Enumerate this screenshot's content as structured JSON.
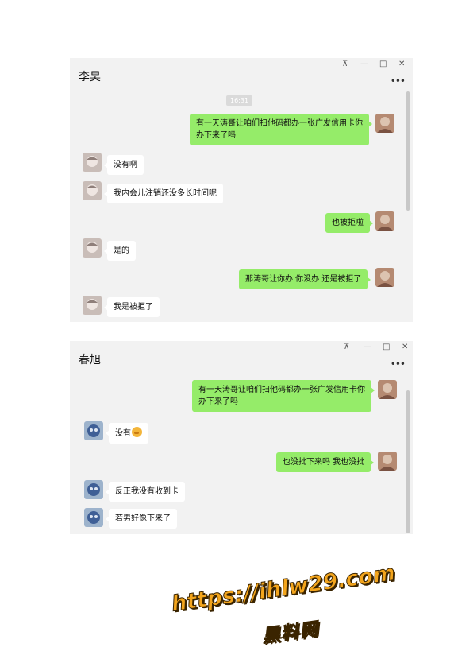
{
  "windows": [
    {
      "title": "李昊",
      "controls": {
        "pin": "⊼",
        "minimize": "—",
        "maximize": "□",
        "close": "✕"
      },
      "more": "•••",
      "timestamp": "16:31",
      "messages": [
        {
          "side": "me",
          "text": "有一天涛哥让咱们扫他码都办一张广发信用卡你办下来了吗"
        },
        {
          "side": "other",
          "text": "没有啊"
        },
        {
          "side": "other",
          "text": "我内会儿注销还没多长时间呢"
        },
        {
          "side": "me",
          "text": "也被拒啦"
        },
        {
          "side": "other",
          "text": "是的"
        },
        {
          "side": "me",
          "text": "那涛哥让你办 你没办 还是被拒了"
        },
        {
          "side": "other",
          "text": "我是被拒了"
        }
      ]
    },
    {
      "title": "春旭",
      "controls": {
        "pin": "⊼",
        "minimize": "—",
        "maximize": "□",
        "close": "✕"
      },
      "more": "•••",
      "messages": [
        {
          "side": "me",
          "text": "有一天涛哥让咱们扫他码都办一张广发信用卡你办下来了吗"
        },
        {
          "side": "other",
          "text": "没有",
          "emoji": "face-emoji"
        },
        {
          "side": "me",
          "text": "也没批下来吗 我也没批"
        },
        {
          "side": "other",
          "text": "反正我没有收到卡"
        },
        {
          "side": "other",
          "text": "若男好像下来了"
        }
      ]
    }
  ],
  "watermark": {
    "url": "https://ihlw29.com",
    "site": "黑料网"
  },
  "colors": {
    "my_bubble": "#95ec69",
    "other_bubble": "#ffffff",
    "window_bg": "#f2f2f2",
    "watermark": "#f3a51d"
  }
}
